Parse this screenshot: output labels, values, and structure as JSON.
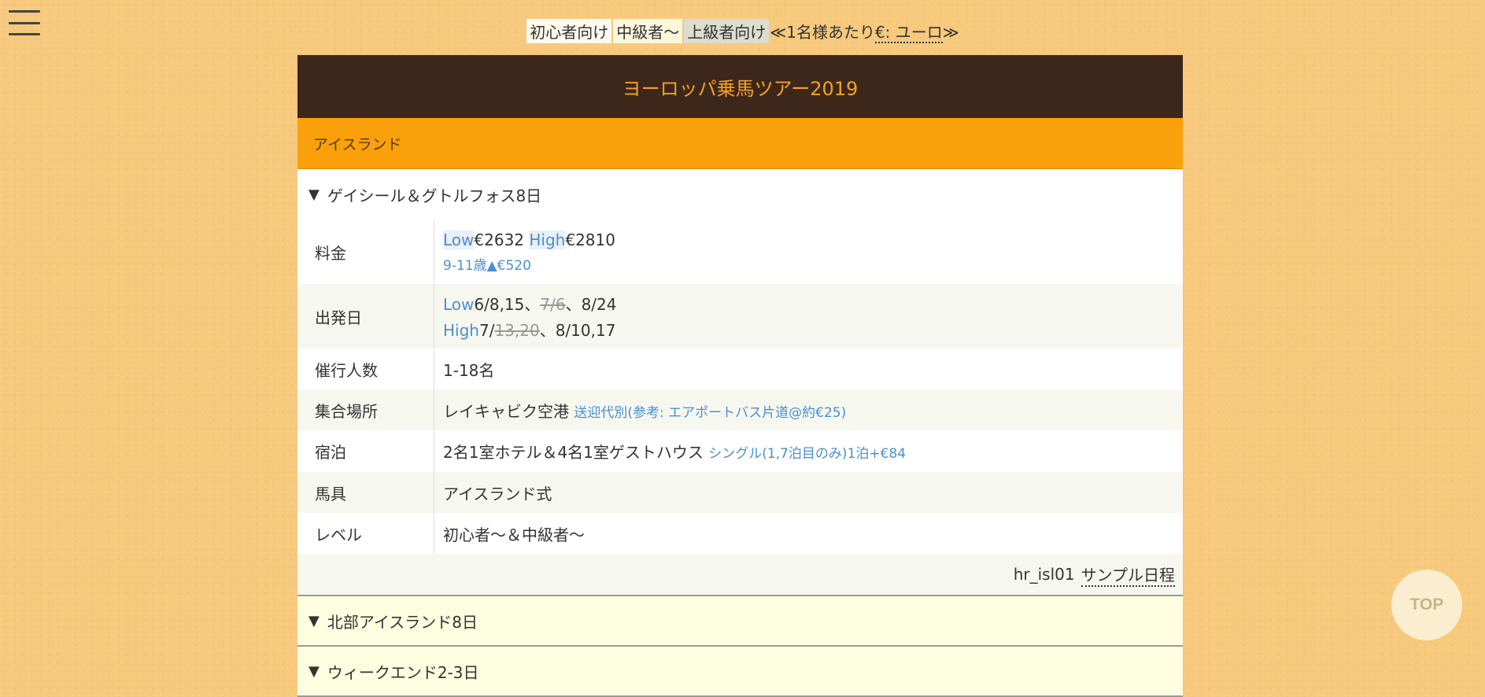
{
  "nav": {
    "menu_icon": "hamburger-menu-icon"
  },
  "topbar": {
    "level_beginner": "初心者向け",
    "level_intermediate": "中級者〜",
    "level_advanced": "上級者向け",
    "price_note_prefix": "≪1名様あたり",
    "currency_label": "€: ユーロ",
    "price_note_suffix": "≫"
  },
  "header": {
    "title": "ヨーロッパ乗馬ツアー2019"
  },
  "region": {
    "name": "アイスランド"
  },
  "tour1": {
    "toggle_icon": "▼",
    "title": "ゲイシール＆グトルフォス8日",
    "price": {
      "label": "料金",
      "low_tag": "Low",
      "low_value": "€2632",
      "high_tag": "High",
      "high_value": "€2810",
      "child_note": "9-11歳▲€520"
    },
    "departure": {
      "label": "出発日",
      "low_tag": "Low",
      "low_pre": "6/8,15、",
      "low_cancelled": "7/6",
      "low_post": "、8/24",
      "high_tag": "High",
      "high_pre": "7/",
      "high_cancelled": "13,20",
      "high_post": "、8/10,17"
    },
    "group": {
      "label": "催行人数",
      "value": "1-18名"
    },
    "meeting": {
      "label": "集合場所",
      "value": "レイキャビク空港",
      "note": "送迎代別(参考: エアポートバス片道@約€25)"
    },
    "lodging": {
      "label": "宿泊",
      "value": "2名1室ホテル＆4名1室ゲストハウス",
      "note": "シングル(1,7泊目のみ)1泊+€84"
    },
    "tack": {
      "label": "馬具",
      "value": "アイスランド式"
    },
    "level": {
      "label": "レベル",
      "value": "初心者〜＆中級者〜"
    },
    "code": "hr_isl01",
    "sample_link": "サンプル日程"
  },
  "tour2": {
    "toggle_icon": "▼",
    "title": "北部アイスランド8日"
  },
  "tour3": {
    "toggle_icon": "▼",
    "title": "ウィークエンド2-3日"
  },
  "scroll_top": {
    "label": "TOP"
  },
  "colors": {
    "header_bg": "#3d271b",
    "header_text": "#f5a223",
    "region_bg": "#f9a00a",
    "accent_blue": "#4a8fd1",
    "page_bg": "#f7c97d"
  }
}
